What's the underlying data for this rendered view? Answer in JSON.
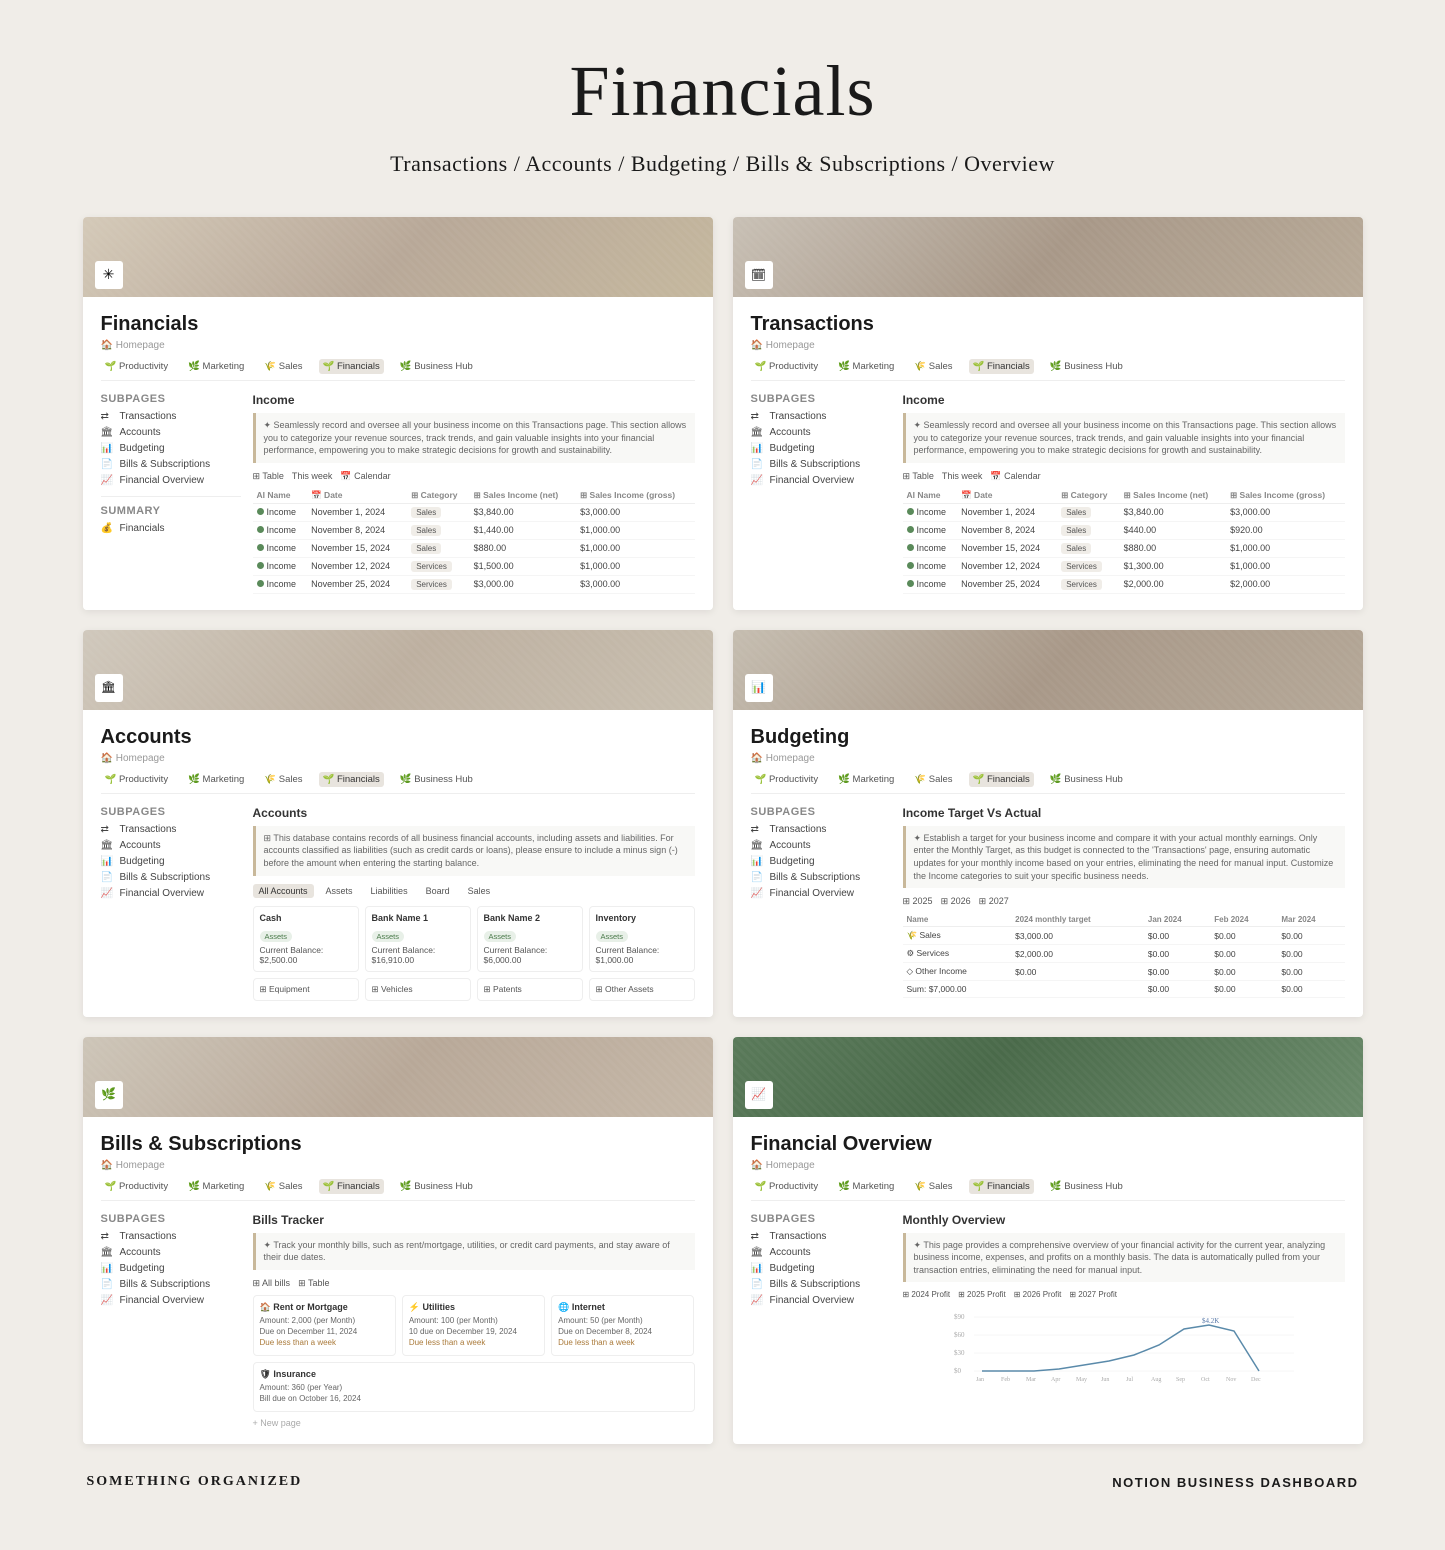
{
  "page": {
    "title": "Financials",
    "subtitle": "Transactions / Accounts / Budgeting / Bills & Subscriptions / Overview",
    "footer_left": "SOMETHING ORGANIZED",
    "footer_right": "NOTION BUSINESS DASHBOARD"
  },
  "cards": [
    {
      "id": "financials",
      "title": "Financials",
      "breadcrumb": "Homepage",
      "banner_class": "banner1",
      "icon": "✳",
      "nav_tabs": [
        "Productivity",
        "Marketing",
        "Sales",
        "Financials",
        "Business Hub"
      ],
      "active_tab": "Financials",
      "subpages": [
        {
          "icon": "⇄",
          "label": "Transactions"
        },
        {
          "icon": "🏛",
          "label": "Accounts"
        },
        {
          "icon": "📊",
          "label": "Budgeting"
        },
        {
          "icon": "📄",
          "label": "Bills & Subscriptions"
        },
        {
          "icon": "📈",
          "label": "Financial Overview"
        }
      ],
      "summary_label": "Summary",
      "summary_items": [
        {
          "icon": "💰",
          "label": "Financials"
        }
      ],
      "section": "Income",
      "info_text": "Seamlessly record and oversee all your business income on this Transactions page. This section allows you to categorize your revenue sources, track trends, and gain valuable insights into your financial performance, empowering you to make strategic decisions for growth and sustainability.",
      "table_headers": [
        "Name",
        "Date",
        "Category",
        "Sales Income (net)",
        "Sales Income (gross)"
      ],
      "table_rows": [
        {
          "dot": "green",
          "name": "Income",
          "date": "November 1, 2024",
          "cat": "Sales",
          "net": "$3,840.00",
          "gross": "$3,000.00"
        },
        {
          "dot": "green",
          "name": "Income",
          "date": "November 8, 2024",
          "cat": "Sales",
          "net": "$1,440.00",
          "gross": "$1,000.00"
        },
        {
          "dot": "green",
          "name": "Income",
          "date": "November 15, 2024",
          "cat": "Sales",
          "net": "$880.00",
          "gross": "$1,000.00"
        },
        {
          "dot": "green",
          "name": "Income",
          "date": "November 12, 2024",
          "cat": "Services",
          "net": "$1,500.00",
          "gross": "$1,000.00"
        },
        {
          "dot": "green",
          "name": "Income",
          "date": "November 25, 2024",
          "cat": "Services",
          "net": "$3,000.00",
          "gross": "$3,000.00"
        }
      ]
    },
    {
      "id": "transactions",
      "title": "Transactions",
      "breadcrumb": "Homepage",
      "banner_class": "banner2",
      "icon": "🗓",
      "nav_tabs": [
        "Productivity",
        "Marketing",
        "Sales",
        "Financials",
        "Business Hub"
      ],
      "active_tab": "Financials",
      "subpages": [
        {
          "icon": "⇄",
          "label": "Transactions"
        },
        {
          "icon": "🏛",
          "label": "Accounts"
        },
        {
          "icon": "📊",
          "label": "Budgeting"
        },
        {
          "icon": "📄",
          "label": "Bills & Subscriptions"
        },
        {
          "icon": "📈",
          "label": "Financial Overview"
        }
      ],
      "section": "Income",
      "info_text": "Seamlessly record and oversee all your business income on this Transactions page. This section allows you to categorize your revenue sources, track trends, and gain valuable insights into your financial performance, empowering you to make strategic decisions for growth and sustainability.",
      "table_headers": [
        "Name",
        "Date",
        "Category",
        "Sales Income (net)",
        "Sales Income (gross)"
      ],
      "table_rows": [
        {
          "dot": "green",
          "name": "Income",
          "date": "November 1, 2024",
          "cat": "Sales",
          "net": "$3,840.00",
          "gross": "$3,000.00"
        },
        {
          "dot": "green",
          "name": "Income",
          "date": "November 8, 2024",
          "cat": "Sales",
          "net": "$440.00",
          "gross": "$920.00"
        },
        {
          "dot": "green",
          "name": "Income",
          "date": "November 15, 2024",
          "cat": "Sales",
          "net": "$880.00",
          "gross": "$1,000.00"
        },
        {
          "dot": "green",
          "name": "Income",
          "date": "November 12, 2024",
          "cat": "Services",
          "net": "$1,300.00",
          "gross": "$1,000.00"
        },
        {
          "dot": "green",
          "name": "Income",
          "date": "November 25, 2024",
          "cat": "Services",
          "net": "$2,000.00",
          "gross": "$2,000.00"
        }
      ]
    },
    {
      "id": "accounts",
      "title": "Accounts",
      "breadcrumb": "Homepage",
      "banner_class": "banner3",
      "icon": "🏛",
      "nav_tabs": [
        "Productivity",
        "Marketing",
        "Sales",
        "Financials",
        "Business Hub"
      ],
      "active_tab": "Financials",
      "subpages": [
        {
          "icon": "⇄",
          "label": "Transactions"
        },
        {
          "icon": "🏛",
          "label": "Accounts"
        },
        {
          "icon": "📊",
          "label": "Budgeting"
        },
        {
          "icon": "📄",
          "label": "Bills & Subscriptions"
        },
        {
          "icon": "📈",
          "label": "Financial Overview"
        }
      ],
      "section": "Accounts",
      "info_text": "This database contains records of all business financial accounts, including assets and liabilities. For accounts classified as liabilities (such as credit cards or loans), please ensure to include a minus sign (-) before the amount when entering the starting balance.",
      "account_tabs": [
        "All Accounts",
        "Assets",
        "Liabilities",
        "Board",
        "Sales"
      ],
      "active_account_tab": "All Accounts",
      "accounts": [
        {
          "title": "Cash",
          "badge": "Assets",
          "balance": "$2,500.00"
        },
        {
          "title": "Bank Name 1",
          "badge": "Assets",
          "balance": "$16,910.00"
        },
        {
          "title": "Bank Name 2",
          "badge": "Assets",
          "balance": "$6,000.00"
        },
        {
          "title": "Inventory",
          "badge": "Assets",
          "balance": "$1,000.00"
        }
      ],
      "more_accounts": [
        "Equipment",
        "Vehicles",
        "Patents",
        "Other Assets"
      ]
    },
    {
      "id": "budgeting",
      "title": "Budgeting",
      "breadcrumb": "Homepage",
      "banner_class": "banner4",
      "icon": "📊",
      "nav_tabs": [
        "Productivity",
        "Marketing",
        "Sales",
        "Financials",
        "Business Hub"
      ],
      "active_tab": "Financials",
      "subpages": [
        {
          "icon": "⇄",
          "label": "Transactions"
        },
        {
          "icon": "🏛",
          "label": "Accounts"
        },
        {
          "icon": "📊",
          "label": "Budgeting"
        },
        {
          "icon": "📄",
          "label": "Bills & Subscriptions"
        },
        {
          "icon": "📈",
          "label": "Financial Overview"
        }
      ],
      "section": "Income Target Vs Actual",
      "info_text": "Establish a target for your business income and compare it with your actual monthly earnings. Only enter the Monthly Target, as this budget is connected to the 'Transactions' page, ensuring automatic updates for your monthly income based on your entries, eliminating the need for manual input. Customize the Income categories to suit your specific business needs.",
      "budget_tabs": [
        "2025",
        "2026",
        "2027"
      ],
      "active_budget_tab": "2025",
      "budget_headers": [
        "Name",
        "2024 monthly target",
        "Jan 2024",
        "Feb 2024",
        "Mar 2024"
      ],
      "budget_rows": [
        {
          "name": "Sales",
          "target": "$3,000.00",
          "jan": "$0.00",
          "feb": "$0.00",
          "mar": "$0.00"
        },
        {
          "name": "Services",
          "target": "$2,000.00",
          "jan": "$0.00",
          "feb": "$0.00",
          "mar": "$0.00"
        },
        {
          "name": "Other Income",
          "target": "$0.00",
          "jan": "$0.00",
          "feb": "$0.00",
          "mar": "$0.00"
        }
      ],
      "budget_totals": {
        "label": "Sum: $7,000.00",
        "jan": "$0.00",
        "feb": "$0.00",
        "mar": "$0.00"
      }
    },
    {
      "id": "bills",
      "title": "Bills & Subscriptions",
      "breadcrumb": "Homepage",
      "banner_class": "banner5",
      "icon": "📄",
      "nav_tabs": [
        "Productivity",
        "Marketing",
        "Sales",
        "Financials",
        "Business Hub"
      ],
      "active_tab": "Financials",
      "subpages": [
        {
          "icon": "⇄",
          "label": "Transactions"
        },
        {
          "icon": "🏛",
          "label": "Accounts"
        },
        {
          "icon": "📊",
          "label": "Budgeting"
        },
        {
          "icon": "📄",
          "label": "Bills & Subscriptions"
        },
        {
          "icon": "📈",
          "label": "Financial Overview"
        }
      ],
      "section": "Bills Tracker",
      "info_text": "Track your monthly bills, such as rent/mortgage, utilities, or credit card payments, and stay aware of their due dates.",
      "bills_tabs": [
        "All bills",
        "Table"
      ],
      "active_bills_tab": "All bills",
      "bills": [
        {
          "title": "Rent or Mortgage",
          "detail1": "Amount: 2,000 (per Month)",
          "detail2": "Due on December 11, 2024",
          "detail3": "Due less than a week"
        },
        {
          "title": "Utilities",
          "detail1": "Amount: 100 (per Month)",
          "detail2": "10 due on December 19, 2024",
          "detail3": "Due less than a week"
        },
        {
          "title": "Internet",
          "detail1": "Amount: 50 (per Month)",
          "detail2": "Due on December 8, 2024",
          "detail3": "Due less than a week"
        },
        {
          "title": "Insurance",
          "detail1": "Amount: 360 (per Year)",
          "detail2": "Bill due on October 16, 2024",
          "detail3": ""
        }
      ]
    },
    {
      "id": "overview",
      "title": "Financial Overview",
      "breadcrumb": "Homepage",
      "banner_class": "banner6",
      "icon": "📈",
      "nav_tabs": [
        "Productivity",
        "Marketing",
        "Sales",
        "Financials",
        "Business Hub"
      ],
      "active_tab": "Financials",
      "subpages": [
        {
          "icon": "⇄",
          "label": "Transactions"
        },
        {
          "icon": "🏛",
          "label": "Accounts"
        },
        {
          "icon": "📊",
          "label": "Budgeting"
        },
        {
          "icon": "📄",
          "label": "Bills & Subscriptions"
        },
        {
          "icon": "📈",
          "label": "Financial Overview"
        }
      ],
      "section": "Monthly Overview",
      "info_text": "This page provides a comprehensive overview of your financial activity for the current year, analyzing business income, expenses, and profits on a monthly basis. The data is automatically pulled from your transaction entries, eliminating the need for manual input.",
      "chart_tabs": [
        "2024 Profit",
        "2025 Profit",
        "2026 Profit",
        "2027 Profit"
      ],
      "active_chart_tab": "2024 Profit",
      "chart_y_labels": [
        "$90",
        "$60",
        "$30",
        "$0"
      ],
      "chart_x_labels": [
        "Jan",
        "Feb",
        "Mar",
        "Apr",
        "May",
        "Jun",
        "Jul",
        "Aug",
        "Sep",
        "Oct",
        "Nov",
        "Dec"
      ],
      "chart_peak_label": "$4.2K"
    }
  ]
}
